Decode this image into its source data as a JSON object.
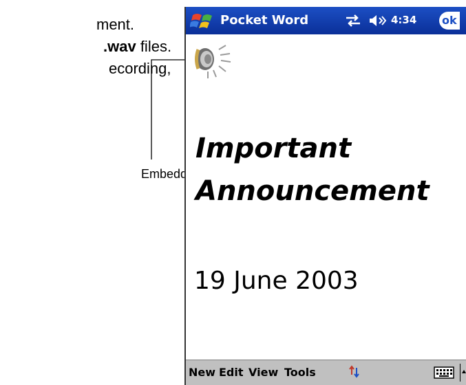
{
  "manual": {
    "line1": "ment.",
    "line2_bold": ".wav",
    "line2_rest": " files.",
    "line3": "ecording,",
    "callout_label": "Embedded recording"
  },
  "device": {
    "app_title": "Pocket Word",
    "clock": "4:34",
    "ok_label": "ok",
    "document": {
      "title_line1": "Important",
      "title_line2": "Announcement",
      "date": "19 June 2003"
    },
    "menu": {
      "new": "New",
      "edit": "Edit",
      "view": "View",
      "tools": "Tools"
    },
    "colors": {
      "titlebar": "#1c4fc4",
      "menubar": "#c0c0c0"
    },
    "icons": [
      "windows-start-icon",
      "connectivity-icon",
      "volume-icon",
      "speaker-recording-icon",
      "sort-icon",
      "keyboard-icon"
    ]
  }
}
